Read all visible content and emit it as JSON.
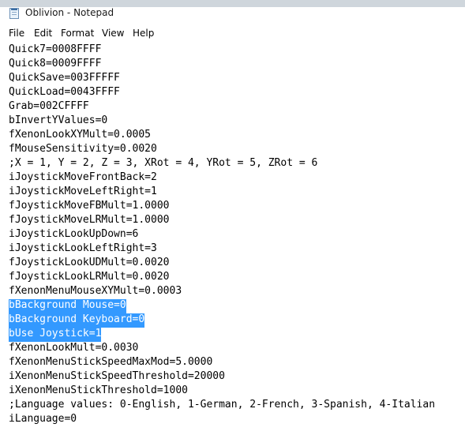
{
  "window": {
    "title": "Oblivion - Notepad",
    "background_strip_colors": [
      "#4a4a4a",
      "#6b7f8f",
      "#2d2d2d",
      "#8a9aa6",
      "#3e4c57"
    ]
  },
  "menu": {
    "items": [
      {
        "id": "file",
        "label": "File"
      },
      {
        "id": "edit",
        "label": "Edit"
      },
      {
        "id": "format",
        "label": "Format"
      },
      {
        "id": "view",
        "label": "View"
      },
      {
        "id": "help",
        "label": "Help"
      }
    ]
  },
  "selection_color": "#3399ff",
  "editor": {
    "lines": [
      {
        "text": "Quick7=0008FFFF",
        "selected": false
      },
      {
        "text": "Quick8=0009FFFF",
        "selected": false
      },
      {
        "text": "QuickSave=003FFFFF",
        "selected": false
      },
      {
        "text": "QuickLoad=0043FFFF",
        "selected": false
      },
      {
        "text": "Grab=002CFFFF",
        "selected": false
      },
      {
        "text": "bInvertYValues=0",
        "selected": false
      },
      {
        "text": "fXenonLookXYMult=0.0005",
        "selected": false
      },
      {
        "text": "fMouseSensitivity=0.0020",
        "selected": false
      },
      {
        "text": ";X = 1, Y = 2, Z = 3, XRot = 4, YRot = 5, ZRot = 6",
        "selected": false
      },
      {
        "text": "iJoystickMoveFrontBack=2",
        "selected": false
      },
      {
        "text": "iJoystickMoveLeftRight=1",
        "selected": false
      },
      {
        "text": "fJoystickMoveFBMult=1.0000",
        "selected": false
      },
      {
        "text": "fJoystickMoveLRMult=1.0000",
        "selected": false
      },
      {
        "text": "iJoystickLookUpDown=6",
        "selected": false
      },
      {
        "text": "iJoystickLookLeftRight=3",
        "selected": false
      },
      {
        "text": "fJoystickLookUDMult=0.0020",
        "selected": false
      },
      {
        "text": "fJoystickLookLRMult=0.0020",
        "selected": false
      },
      {
        "text": "fXenonMenuMouseXYMult=0.0003",
        "selected": false
      },
      {
        "text": "bBackground Mouse=0",
        "selected": true
      },
      {
        "text": "bBackground Keyboard=0",
        "selected": true
      },
      {
        "text": "bUse Joystick=1",
        "selected": true
      },
      {
        "text": "fXenonLookMult=0.0030",
        "selected": false
      },
      {
        "text": "fXenonMenuStickSpeedMaxMod=5.0000",
        "selected": false
      },
      {
        "text": "iXenonMenuStickSpeedThreshold=20000",
        "selected": false
      },
      {
        "text": "iXenonMenuStickThreshold=1000",
        "selected": false
      },
      {
        "text": ";Language values: 0-English, 1-German, 2-French, 3-Spanish, 4-Italian",
        "selected": false
      },
      {
        "text": "iLanguage=0",
        "selected": false
      }
    ]
  }
}
